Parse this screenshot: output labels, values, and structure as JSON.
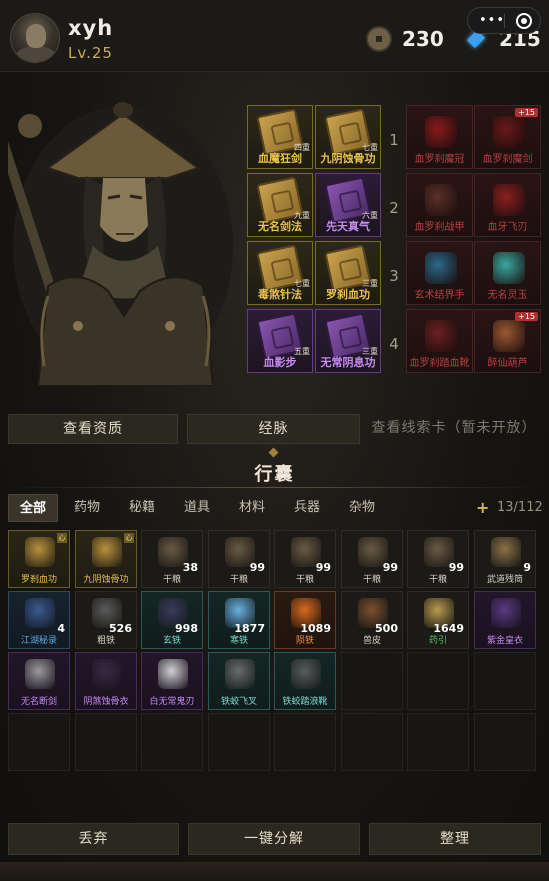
{
  "player": {
    "name": "xyh",
    "level": "Lv.25"
  },
  "currency": {
    "coins": "230",
    "gems": "215"
  },
  "capsule": {
    "dots": "•••"
  },
  "skills": [
    {
      "name": "血魔狂剑",
      "tier": "四重",
      "color": "gold"
    },
    {
      "name": "九阴蚀骨功",
      "tier": "七重",
      "color": "gold"
    },
    {
      "name": "无名剑法",
      "tier": "九重",
      "color": "gold"
    },
    {
      "name": "先天真气",
      "tier": "六重",
      "color": "purple"
    },
    {
      "name": "毒煞针法",
      "tier": "七重",
      "color": "gold"
    },
    {
      "name": "罗刹血功",
      "tier": "三重",
      "color": "gold"
    },
    {
      "name": "血影步",
      "tier": "五重",
      "color": "purple"
    },
    {
      "name": "无常阴息功",
      "tier": "三重",
      "color": "purple"
    }
  ],
  "row_numbers": [
    "1",
    "2",
    "3",
    "4"
  ],
  "equipment": [
    {
      "name": "血罗刹魔冠",
      "plus": "",
      "icon_color": "#8a1a1a"
    },
    {
      "name": "血罗刹魔剑",
      "plus": "+15",
      "icon_color": "#6a1818"
    },
    {
      "name": "血罗刹战甲",
      "plus": "",
      "icon_color": "#5a3028"
    },
    {
      "name": "血牙飞刃",
      "plus": "",
      "icon_color": "#8a2020"
    },
    {
      "name": "玄术结界手",
      "plus": "",
      "icon_color": "#2a6a8a"
    },
    {
      "name": "无名灵玉",
      "plus": "",
      "icon_color": "#3aa8a0"
    },
    {
      "name": "血罗刹踏血靴",
      "plus": "",
      "icon_color": "#6a2020"
    },
    {
      "name": "醉仙葫芦",
      "plus": "+15",
      "icon_color": "#9a5a30"
    }
  ],
  "action_buttons": [
    "查看资质",
    "经脉",
    "查看线索卡（暂未开放）"
  ],
  "bag": {
    "title": "行囊",
    "capacity": "13/112",
    "add": "+"
  },
  "tabs": [
    "全部",
    "药物",
    "秘籍",
    "道具",
    "材料",
    "兵器",
    "杂物"
  ],
  "inventory": [
    {
      "name": "罗刹血功",
      "count": "",
      "rarity": "gold",
      "lock": "心",
      "icon_color": "#b8923c"
    },
    {
      "name": "九阴蚀骨功",
      "count": "",
      "rarity": "gold",
      "lock": "心",
      "icon_color": "#b8923c"
    },
    {
      "name": "干粮",
      "count": "38",
      "rarity": "",
      "lock": "",
      "icon_color": "#6a5a44"
    },
    {
      "name": "干粮",
      "count": "99",
      "rarity": "",
      "lock": "",
      "icon_color": "#6a5a44"
    },
    {
      "name": "干粮",
      "count": "99",
      "rarity": "",
      "lock": "",
      "icon_color": "#6a5a44"
    },
    {
      "name": "干粮",
      "count": "99",
      "rarity": "",
      "lock": "",
      "icon_color": "#6a5a44"
    },
    {
      "name": "干粮",
      "count": "99",
      "rarity": "",
      "lock": "",
      "icon_color": "#6a5a44"
    },
    {
      "name": "武道残简",
      "count": "9",
      "rarity": "",
      "lock": "",
      "icon_color": "#8a7048"
    },
    {
      "name": "江湖秘录",
      "count": "4",
      "rarity": "blue",
      "lock": "",
      "icon_color": "#3a5a90"
    },
    {
      "name": "粗铁",
      "count": "526",
      "rarity": "",
      "lock": "",
      "icon_color": "#5a5a5a"
    },
    {
      "name": "玄铁",
      "count": "998",
      "rarity": "teal",
      "lock": "",
      "icon_color": "#3a3a5a"
    },
    {
      "name": "寒铁",
      "count": "1877",
      "rarity": "teal",
      "lock": "",
      "icon_color": "#6ab0e0"
    },
    {
      "name": "陨铁",
      "count": "1089",
      "rarity": "orange",
      "lock": "",
      "icon_color": "#d86a20"
    },
    {
      "name": "兽皮",
      "count": "500",
      "rarity": "",
      "lock": "",
      "icon_color": "#7a5030"
    },
    {
      "name": "药引",
      "count": "1649",
      "rarity": "green",
      "lock": "",
      "icon_color": "#b89a50"
    },
    {
      "name": "紫金皇衣",
      "count": "",
      "rarity": "purple",
      "lock": "",
      "icon_color": "#5a3a80"
    },
    {
      "name": "无名断剑",
      "count": "",
      "rarity": "purple",
      "lock": "",
      "icon_color": "#9a9a9a"
    },
    {
      "name": "阴煞蚀骨衣",
      "count": "",
      "rarity": "purple",
      "lock": "",
      "icon_color": "#3a2a44"
    },
    {
      "name": "白无常鬼刃",
      "count": "",
      "rarity": "purple",
      "lock": "",
      "icon_color": "#d0d0d0"
    },
    {
      "name": "铁蛟飞叉",
      "count": "",
      "rarity": "teal",
      "lock": "",
      "icon_color": "#6a6a6a"
    },
    {
      "name": "铁蛟踏浪靴",
      "count": "",
      "rarity": "teal",
      "lock": "",
      "icon_color": "#5a5a5a"
    }
  ],
  "bottom_buttons": [
    "丢弃",
    "一键分解",
    "整理"
  ],
  "colors": {
    "gold": "#e8c24a",
    "purple": "#c88af0",
    "red": "#b84040",
    "blue": "#5aa8e8"
  }
}
